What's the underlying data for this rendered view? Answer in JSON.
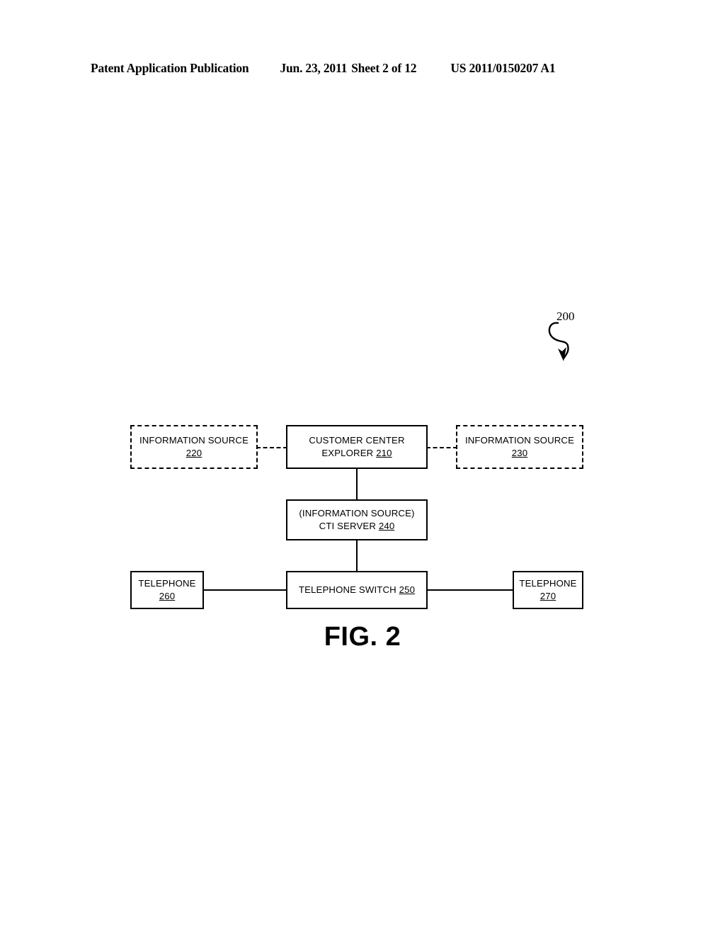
{
  "header": {
    "title": "Patent Application Publication",
    "date": "Jun. 23, 2011",
    "sheet": "Sheet 2 of 12",
    "doc_number": "US 2011/0150207 A1"
  },
  "figure": {
    "caption": "FIG. 2",
    "reference_label": "200"
  },
  "diagram": {
    "boxes": [
      {
        "id": "info-220",
        "line1": "INFORMATION SOURCE",
        "refnum": "220",
        "style": "dashed"
      },
      {
        "id": "cce-210",
        "line1": "CUSTOMER CENTER",
        "line2": "EXPLORER",
        "refnum": "210",
        "style": "solid"
      },
      {
        "id": "info-230",
        "line1": "INFORMATION SOURCE",
        "refnum": "230",
        "style": "dashed"
      },
      {
        "id": "cti-240",
        "line1": "(INFORMATION SOURCE)",
        "line2": "CTI SERVER",
        "refnum": "240",
        "style": "solid"
      },
      {
        "id": "tel-260",
        "line1": "TELEPHONE",
        "refnum": "260",
        "style": "solid"
      },
      {
        "id": "switch-250",
        "line1": "TELEPHONE SWITCH",
        "refnum": "250",
        "style": "solid"
      },
      {
        "id": "tel-270",
        "line1": "TELEPHONE",
        "refnum": "270",
        "style": "solid"
      }
    ],
    "connectors": [
      {
        "id": "220-210",
        "from": "info-220",
        "to": "cce-210",
        "style": "dashed"
      },
      {
        "id": "210-230",
        "from": "cce-210",
        "to": "info-230",
        "style": "dashed"
      },
      {
        "id": "210-240",
        "from": "cce-210",
        "to": "cti-240",
        "style": "solid"
      },
      {
        "id": "240-250",
        "from": "cti-240",
        "to": "switch-250",
        "style": "solid"
      },
      {
        "id": "260-250",
        "from": "tel-260",
        "to": "switch-250",
        "style": "solid"
      },
      {
        "id": "250-270",
        "from": "switch-250",
        "to": "tel-270",
        "style": "solid"
      }
    ]
  },
  "colors": {
    "ink": "#000000",
    "page": "#ffffff"
  }
}
